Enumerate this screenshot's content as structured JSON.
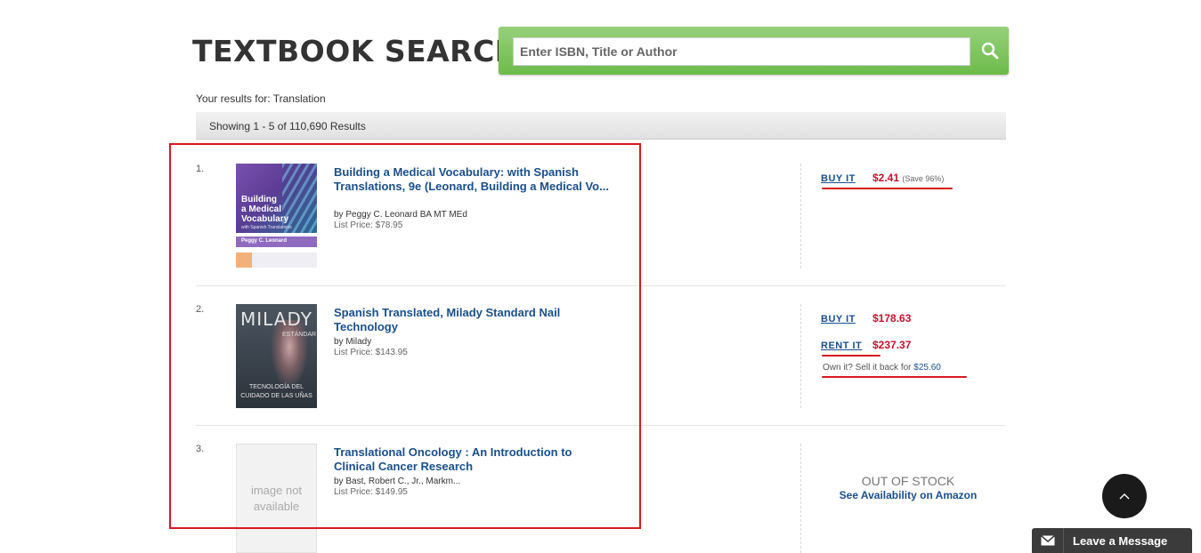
{
  "header": {
    "title": "TEXTBOOK SEARCH"
  },
  "search": {
    "placeholder": "Enter ISBN, Title or Author",
    "icon": "search-icon"
  },
  "query": {
    "label": "Your results for:",
    "term": "Translation"
  },
  "showing": "Showing 1 - 5 of 110,690 Results",
  "results": [
    {
      "index": "1.",
      "title": "Building a Medical Vocabulary: with Spanish Translations, 9e (Leonard, Building a Medical Vo...",
      "author": "by Peggy C. Leonard BA MT MEd",
      "list_price": "List Price: $78.95",
      "cover": {
        "line1": "Building",
        "line2": "a Medical",
        "line3": "Vocabulary",
        "sub": "with Spanish Translations",
        "author": "Peggy C. Leonard"
      },
      "buy_label": "BUY IT",
      "buy_price": "$2.41",
      "save": "(Save 96%)"
    },
    {
      "index": "2.",
      "title": "Spanish Translated, Milady Standard Nail Technology",
      "author": "by Milady",
      "list_price": "List Price: $143.95",
      "cover": {
        "brand": "MILADY",
        "edition": "ESTÁNDAR",
        "line1": "TECNOLOGÍA DEL",
        "line2": "CUIDADO DE LAS UÑAS"
      },
      "buy_label": "BUY IT",
      "buy_price": "$178.63",
      "rent_label": "RENT IT",
      "rent_price": "$237.37",
      "sell_text": "Own it? Sell it back for",
      "sell_price": "$25.60"
    },
    {
      "index": "3.",
      "title": "Translational Oncology : An Introduction to Clinical Cancer Research",
      "author": "by Bast, Robert C., Jr., Markm...",
      "list_price": "List Price: $149.95",
      "cover": {
        "line1": "image not",
        "line2": "available"
      },
      "stock": "OUT OF STOCK",
      "amazon": "See Availability on Amazon"
    }
  ],
  "widgets": {
    "leave_message": "Leave a Message"
  },
  "colors": {
    "accent_green": "#6dbb4a",
    "link_blue": "#1a4f8c",
    "price_red": "#c8102e",
    "highlight_red": "#d71920"
  }
}
